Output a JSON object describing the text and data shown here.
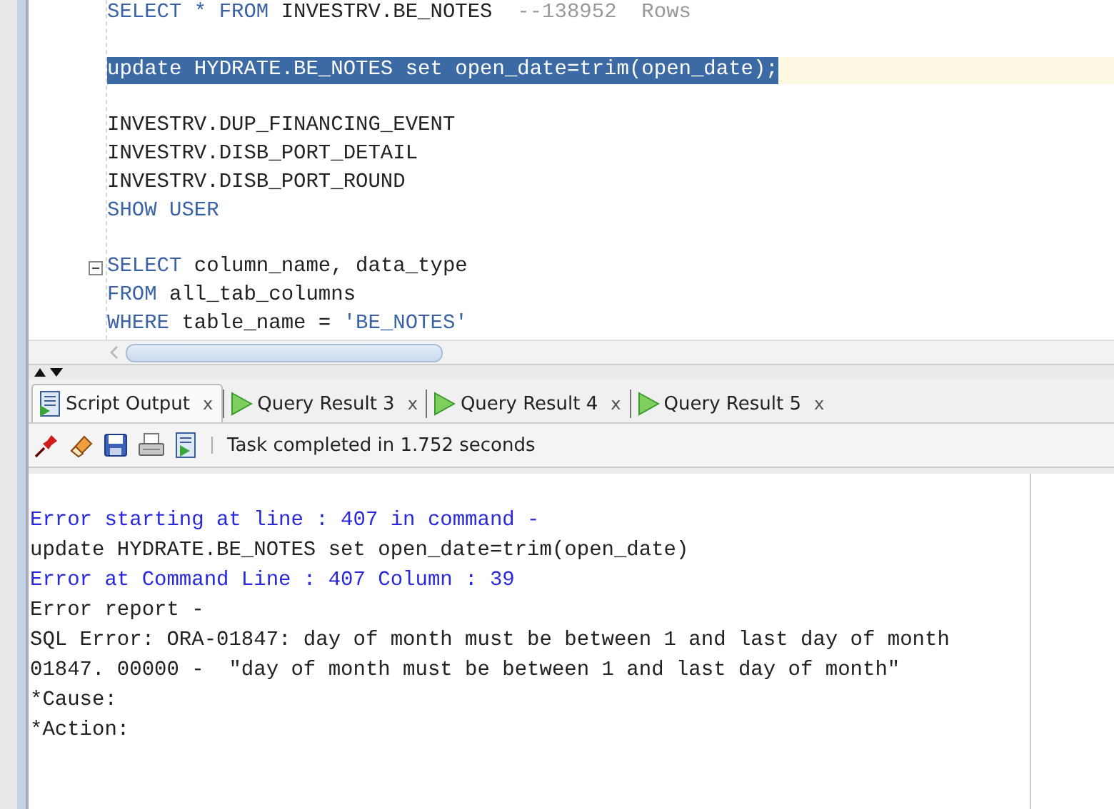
{
  "editor": {
    "lines": [
      {
        "kind": "code",
        "selected": false,
        "fold_marker": false,
        "segments": [
          {
            "kind": "keyword",
            "text": "SELECT * FROM"
          },
          {
            "kind": "plain",
            "text": " INVESTRV.BE_NOTES  "
          },
          {
            "kind": "comment",
            "text": "--138952  Rows"
          }
        ]
      },
      {
        "kind": "blank"
      },
      {
        "kind": "code",
        "selected": true,
        "fold_marker": false,
        "segments": [
          {
            "kind": "plain",
            "text": "update HYDRATE.BE_NOTES set open_date=trim(open_date);"
          }
        ]
      },
      {
        "kind": "blank"
      },
      {
        "kind": "code",
        "selected": false,
        "fold_marker": false,
        "segments": [
          {
            "kind": "plain",
            "text": "INVESTRV.DUP_FINANCING_EVENT"
          }
        ]
      },
      {
        "kind": "code",
        "selected": false,
        "fold_marker": false,
        "segments": [
          {
            "kind": "plain",
            "text": "INVESTRV.DISB_PORT_DETAIL"
          }
        ]
      },
      {
        "kind": "code",
        "selected": false,
        "fold_marker": false,
        "segments": [
          {
            "kind": "plain",
            "text": "INVESTRV.DISB_PORT_ROUND"
          }
        ]
      },
      {
        "kind": "code",
        "selected": false,
        "fold_marker": false,
        "segments": [
          {
            "kind": "keyword",
            "text": "SHOW USER"
          }
        ]
      },
      {
        "kind": "blank"
      },
      {
        "kind": "code",
        "selected": false,
        "fold_marker": true,
        "segments": [
          {
            "kind": "keyword",
            "text": "SELECT"
          },
          {
            "kind": "plain",
            "text": " column_name, data_type"
          }
        ]
      },
      {
        "kind": "code",
        "selected": false,
        "fold_marker": false,
        "segments": [
          {
            "kind": "keyword",
            "text": "FROM"
          },
          {
            "kind": "plain",
            "text": " all_tab_columns"
          }
        ]
      },
      {
        "kind": "code",
        "selected": false,
        "fold_marker": false,
        "segments": [
          {
            "kind": "keyword",
            "text": "WHERE"
          },
          {
            "kind": "plain",
            "text": " table_name = "
          },
          {
            "kind": "string",
            "text": "'BE_NOTES'"
          }
        ]
      }
    ]
  },
  "tabs": [
    {
      "kind": "output",
      "label": "Script Output",
      "close": "x",
      "selected": true
    },
    {
      "kind": "result",
      "label": "Query Result 3",
      "close": "x",
      "selected": false
    },
    {
      "kind": "result",
      "label": "Query Result 4",
      "close": "x",
      "selected": false
    },
    {
      "kind": "result",
      "label": "Query Result 5",
      "close": "x",
      "selected": false
    }
  ],
  "toolbar": {
    "status": "Task completed in 1.752 seconds"
  },
  "output": [
    {
      "kind": "info",
      "text": "Error starting at line : 407 in command -"
    },
    {
      "kind": "plain",
      "text": "update HYDRATE.BE_NOTES set open_date=trim(open_date)"
    },
    {
      "kind": "info",
      "text": "Error at Command Line : 407 Column : 39"
    },
    {
      "kind": "plain",
      "text": "Error report -"
    },
    {
      "kind": "plain",
      "text": "SQL Error: ORA-01847: day of month must be between 1 and last day of month"
    },
    {
      "kind": "plain",
      "text": "01847. 00000 -  \"day of month must be between 1 and last day of month\""
    },
    {
      "kind": "plain",
      "text": "*Cause:"
    },
    {
      "kind": "plain",
      "text": "*Action:"
    }
  ]
}
